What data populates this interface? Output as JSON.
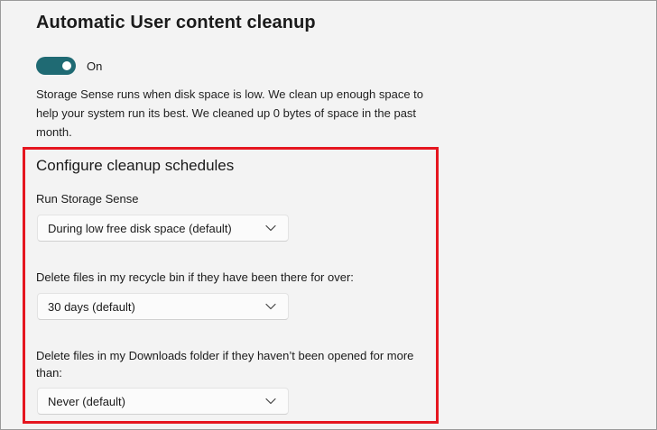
{
  "header": {
    "title": "Automatic User content cleanup"
  },
  "toggle": {
    "label": "On",
    "state": "on",
    "accent_color": "#1f6a73"
  },
  "description": "Storage Sense runs when disk space is low. We clean up enough space to help your system run its best. We cleaned up 0 bytes of space in the past month.",
  "schedules": {
    "heading": "Configure cleanup schedules",
    "highlight_color": "#e5161f",
    "run_storage_sense": {
      "label": "Run Storage Sense",
      "value": "During low free disk space (default)"
    },
    "recycle_bin": {
      "label": "Delete files in my recycle bin if they have been there for over:",
      "value": "30 days (default)"
    },
    "downloads": {
      "label": "Delete files in my Downloads folder if they haven’t been opened for more than:",
      "value": "Never (default)"
    }
  },
  "icons": {
    "dropdown": "chevron-down-icon"
  }
}
